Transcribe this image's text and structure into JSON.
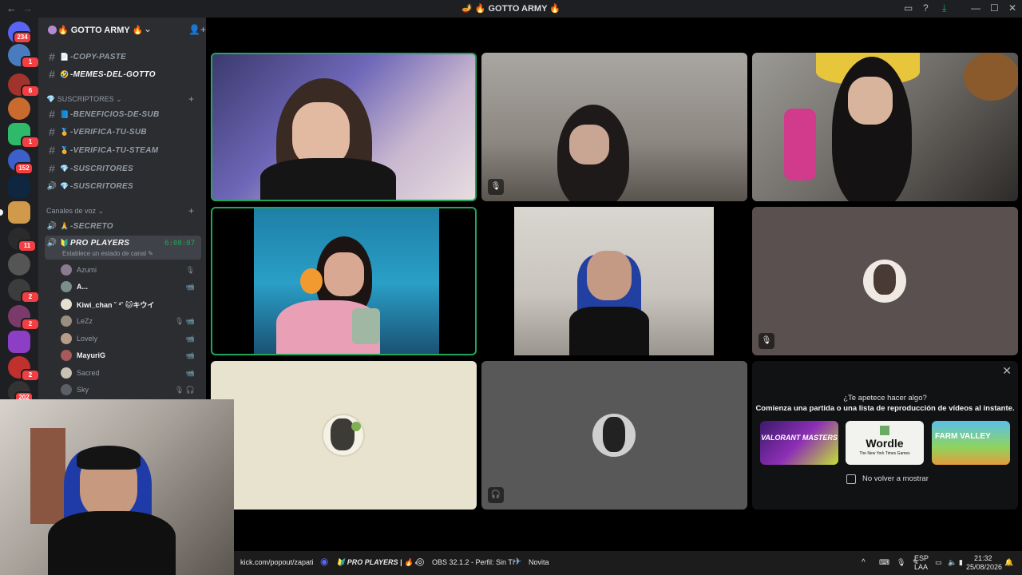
{
  "window": {
    "title": "🪔 🔥 GOTTO ARMY 🔥",
    "back_icon": "←",
    "forward_icon": "→"
  },
  "guilds": {
    "badges": [
      "234",
      "1",
      "6",
      "1",
      "152",
      "11",
      "2",
      "2",
      "2",
      "202"
    ]
  },
  "server": {
    "name": "🔥 GOTTO ARMY 🔥",
    "chevron": "⌄",
    "channels_top": [
      {
        "emoji": "📄",
        "name": "-COPY-PASTE"
      },
      {
        "emoji": "🤣",
        "name": "-MEMES-DEL-GOTTO"
      }
    ],
    "category_subs": "SUSCRIPTORES",
    "channels_subs": [
      {
        "icon": "#",
        "emoji": "📘",
        "name": "-BENEFICIOS-DE-SUB"
      },
      {
        "icon": "#",
        "emoji": "🏅",
        "name": "-VERIFICA-TU-SUB"
      },
      {
        "icon": "#",
        "emoji": "🏅",
        "name": "-VERIFICA-TU-STEAM"
      },
      {
        "icon": "#",
        "emoji": "💎",
        "name": "-SUSCRITORES"
      },
      {
        "icon": "🔊",
        "emoji": "💎",
        "name": "-SUSCRITORES"
      }
    ],
    "category_voice": "Canales de voz",
    "voice_secret": {
      "emoji": "🙏",
      "name": "-SECRETO"
    },
    "voice_active": {
      "emoji": "🔰",
      "name": "PRO PLAYERS",
      "timer": "6:08:07",
      "status": "Establece un estado de canal ✎"
    },
    "members": [
      {
        "name": "Azumi",
        "icon": "🎙",
        "bright": false,
        "color": "#8a7b90"
      },
      {
        "name": "A...",
        "icon": "📹",
        "bright": true,
        "color": "#7b8f8a"
      },
      {
        "name": "Kiwi_chan ˘ ³˘ 🐱キウイ",
        "icon": "",
        "bright": true,
        "color": "#e5e0d0"
      },
      {
        "name": "LeZz",
        "icon": "🎙 📹",
        "bright": false,
        "color": "#9a8e7f"
      },
      {
        "name": "Lovely",
        "icon": "📹",
        "bright": false,
        "color": "#b79c88"
      },
      {
        "name": "MayuriG",
        "icon": "📹",
        "bright": true,
        "color": "#a65a5a"
      },
      {
        "name": "Sacred",
        "icon": "📹",
        "bright": false,
        "color": "#c9c2b3"
      },
      {
        "name": "Sky",
        "icon": "🎙 🎧",
        "bright": false,
        "color": "#5c5f66"
      }
    ]
  },
  "activity": {
    "title": "¿Te apetece hacer algo?",
    "subtitle": "Comienza una partida o una lista de reproducción de vídeos al instante.",
    "close": "✕",
    "card1": "VALORANT MASTERS",
    "card2": "Wordle",
    "card2_sub": "The New York Times Games",
    "card3": "FARM VALLEY",
    "checkbox_label": "No volver a mostrar"
  },
  "taskbar": {
    "url": "kick.com/popout/zapati",
    "discord": "🔰 PRO PLAYERS | 🔥 ‹",
    "obs": "OBS 32.1.2 - Perfil: Sin Tí",
    "novita": "Novita",
    "lang": "ESP",
    "lang2": "LAA",
    "time": "21:32",
    "date": "25/08/2026"
  }
}
